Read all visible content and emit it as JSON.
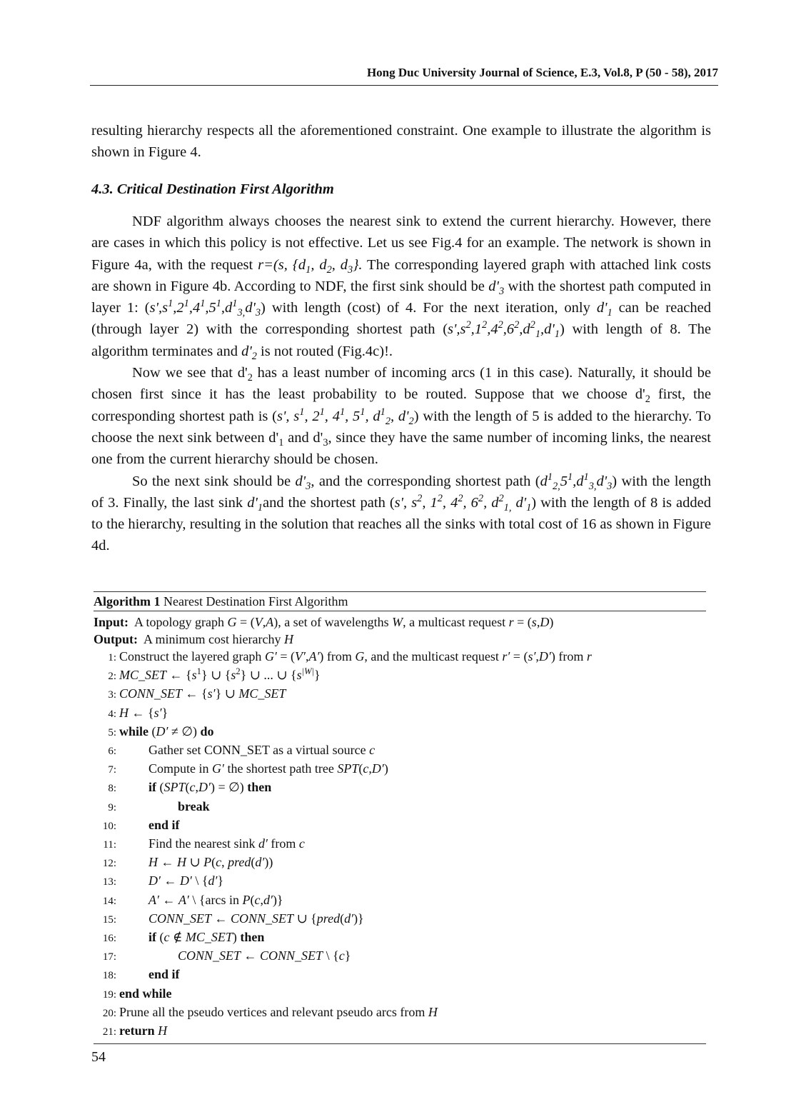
{
  "header": {
    "running_title": "Hong Duc University Journal of Science, E.3, Vol.8, P (50 - 58), 2017"
  },
  "paragraphs_top": [
    {
      "indent": false,
      "segments": [
        {
          "t": "resulting hierarchy respects all the aforementioned constraint. One example to illustrate the algorithm is shown in Figure 4."
        }
      ]
    }
  ],
  "section": {
    "heading": "4.3. Critical Destination First Algorithm"
  },
  "paragraphs_main": [
    {
      "indent": true,
      "segments": [
        {
          "t": "NDF algorithm always chooses the nearest sink to extend the current hierarchy. However, there are cases in which this policy is not effective. Let us see Fig.4 for an example. The network is shown in Figure 4a, with the request "
        },
        {
          "t": "r=(s, {d",
          "i": true
        },
        {
          "t": "1",
          "i": true,
          "sub": true
        },
        {
          "t": ", d",
          "i": true
        },
        {
          "t": "2",
          "i": true,
          "sub": true
        },
        {
          "t": ", d",
          "i": true
        },
        {
          "t": "3",
          "i": true,
          "sub": true
        },
        {
          "t": "}.",
          "i": true
        },
        {
          "t": " The corresponding layered graph with attached link costs are shown in Figure 4b. According to NDF, the first sink should be "
        },
        {
          "t": "d'",
          "i": true
        },
        {
          "t": "3",
          "i": true,
          "sub": true
        },
        {
          "t": " with the shortest path computed in layer 1: ("
        },
        {
          "t": "s',s",
          "i": true
        },
        {
          "t": "1",
          "i": true,
          "sup": true
        },
        {
          "t": ",2",
          "i": true
        },
        {
          "t": "1",
          "i": true,
          "sup": true
        },
        {
          "t": ",4",
          "i": true
        },
        {
          "t": "1",
          "i": true,
          "sup": true
        },
        {
          "t": ",5",
          "i": true
        },
        {
          "t": "1",
          "i": true,
          "sup": true
        },
        {
          "t": ",d",
          "i": true
        },
        {
          "t": "1",
          "i": true,
          "sup": true
        },
        {
          "t": "3,",
          "i": true,
          "sub": true
        },
        {
          "t": "d'",
          "i": true
        },
        {
          "t": "3",
          "i": true,
          "sub": true
        },
        {
          "t": ") with length (cost) of 4. For the next iteration, only "
        },
        {
          "t": "d'",
          "i": true
        },
        {
          "t": "1",
          "i": true,
          "sub": true
        },
        {
          "t": " can be reached (through layer 2) with the corresponding shortest path ("
        },
        {
          "t": "s',s",
          "i": true
        },
        {
          "t": "2",
          "i": true,
          "sup": true
        },
        {
          "t": ",1",
          "i": true
        },
        {
          "t": "2",
          "i": true,
          "sup": true
        },
        {
          "t": ",4",
          "i": true
        },
        {
          "t": "2",
          "i": true,
          "sup": true
        },
        {
          "t": ",6",
          "i": true
        },
        {
          "t": "2",
          "i": true,
          "sup": true
        },
        {
          "t": ",d",
          "i": true
        },
        {
          "t": "2",
          "i": true,
          "sup": true
        },
        {
          "t": "1",
          "i": true,
          "sub": true
        },
        {
          "t": ",d'",
          "i": true
        },
        {
          "t": "1",
          "i": true,
          "sub": true
        },
        {
          "t": ") with length of 8. The algorithm terminates and "
        },
        {
          "t": "d'",
          "i": true
        },
        {
          "t": "2",
          "i": true,
          "sub": true
        },
        {
          "t": " is not routed (Fig.4c)!."
        }
      ]
    },
    {
      "indent": true,
      "segments": [
        {
          "t": "Now we see that d'"
        },
        {
          "t": "2",
          "sub": true
        },
        {
          "t": " has a least number of incoming arcs (1 in this case). Naturally, it should be chosen first since it has the least probability to be routed. Suppose that we choose d'"
        },
        {
          "t": "2",
          "sub": true
        },
        {
          "t": " first, the corresponding shortest path is ("
        },
        {
          "t": "s', s",
          "i": true
        },
        {
          "t": "1",
          "i": true,
          "sup": true
        },
        {
          "t": ", 2",
          "i": true
        },
        {
          "t": "1",
          "i": true,
          "sup": true
        },
        {
          "t": ", 4",
          "i": true
        },
        {
          "t": "1",
          "i": true,
          "sup": true
        },
        {
          "t": ", 5",
          "i": true
        },
        {
          "t": "1",
          "i": true,
          "sup": true
        },
        {
          "t": ", d",
          "i": true
        },
        {
          "t": "1",
          "i": true,
          "sup": true
        },
        {
          "t": "2",
          "i": true,
          "sub": true
        },
        {
          "t": ", d'",
          "i": true
        },
        {
          "t": "2",
          "i": true,
          "sub": true
        },
        {
          "t": ") with the length of 5 is added to the hierarchy. To choose the next sink between d'"
        },
        {
          "t": "1",
          "sub": true
        },
        {
          "t": " and d'"
        },
        {
          "t": "3",
          "sub": true
        },
        {
          "t": ", since they have the same number of incoming links, the nearest one from the current hierarchy should be chosen."
        }
      ]
    },
    {
      "indent": true,
      "segments": [
        {
          "t": "So the next sink should be "
        },
        {
          "t": "d'",
          "i": true
        },
        {
          "t": "3",
          "i": true,
          "sub": true
        },
        {
          "t": ", and the corresponding shortest path ("
        },
        {
          "t": "d",
          "i": true
        },
        {
          "t": "1",
          "i": true,
          "sup": true
        },
        {
          "t": "2,",
          "i": true,
          "sub": true
        },
        {
          "t": "5",
          "i": true
        },
        {
          "t": "1",
          "i": true,
          "sup": true
        },
        {
          "t": ",d",
          "i": true
        },
        {
          "t": "1",
          "i": true,
          "sup": true
        },
        {
          "t": "3,",
          "i": true,
          "sub": true
        },
        {
          "t": "d'",
          "i": true
        },
        {
          "t": "3",
          "i": true,
          "sub": true
        },
        {
          "t": ") with the length of 3. Finally, the last sink "
        },
        {
          "t": "d'",
          "i": true
        },
        {
          "t": "1",
          "i": true,
          "sub": true
        },
        {
          "t": "and the shortest path ("
        },
        {
          "t": "s', s",
          "i": true
        },
        {
          "t": "2",
          "i": true,
          "sup": true
        },
        {
          "t": ", 1",
          "i": true
        },
        {
          "t": "2",
          "i": true,
          "sup": true
        },
        {
          "t": ", 4",
          "i": true
        },
        {
          "t": "2",
          "i": true,
          "sup": true
        },
        {
          "t": ", 6",
          "i": true
        },
        {
          "t": "2",
          "i": true,
          "sup": true
        },
        {
          "t": ", d",
          "i": true
        },
        {
          "t": "2",
          "i": true,
          "sup": true
        },
        {
          "t": "1,",
          "i": true,
          "sub": true
        },
        {
          "t": " d'",
          "i": true
        },
        {
          "t": "1",
          "i": true,
          "sub": true
        },
        {
          "t": ") with the length of 8 is added to the hierarchy, resulting in the solution that reaches all the sinks with total cost of 16 as shown in Figure 4d."
        }
      ]
    }
  ],
  "algorithm": {
    "caption_label": "Algorithm 1",
    "caption_title": "Nearest Destination First Algorithm",
    "input_label": "Input:",
    "input_segments": [
      {
        "t": "A topology graph "
      },
      {
        "t": "G",
        "i": true
      },
      {
        "t": " = ("
      },
      {
        "t": "V",
        "i": true
      },
      {
        "t": ","
      },
      {
        "t": "A",
        "i": true
      },
      {
        "t": "), a set of wavelengths "
      },
      {
        "t": "W",
        "i": true
      },
      {
        "t": ", a multicast request "
      },
      {
        "t": "r",
        "i": true
      },
      {
        "t": " = ("
      },
      {
        "t": "s",
        "i": true
      },
      {
        "t": ","
      },
      {
        "t": "D",
        "i": true
      },
      {
        "t": ")"
      }
    ],
    "output_label": "Output:",
    "output_segments": [
      {
        "t": "A minimum cost hierarchy "
      },
      {
        "t": "H",
        "i": true
      }
    ],
    "lines": [
      {
        "n": "1:",
        "level": 0,
        "segments": [
          {
            "t": "Construct the layered graph "
          },
          {
            "t": "G′",
            "i": true
          },
          {
            "t": " = ("
          },
          {
            "t": "V′",
            "i": true
          },
          {
            "t": ","
          },
          {
            "t": "A′",
            "i": true
          },
          {
            "t": ") from "
          },
          {
            "t": "G",
            "i": true
          },
          {
            "t": ", and the multicast request "
          },
          {
            "t": "r′",
            "i": true
          },
          {
            "t": " = ("
          },
          {
            "t": "s′",
            "i": true
          },
          {
            "t": ","
          },
          {
            "t": "D′",
            "i": true
          },
          {
            "t": ") from "
          },
          {
            "t": "r",
            "i": true
          }
        ]
      },
      {
        "n": "2:",
        "level": 0,
        "segments": [
          {
            "t": "MC_SET",
            "i": true
          },
          {
            "t": " ← {"
          },
          {
            "t": "s",
            "i": true
          },
          {
            "t": "1",
            "sup": true
          },
          {
            "t": "} ∪ {"
          },
          {
            "t": "s",
            "i": true
          },
          {
            "t": "2",
            "sup": true
          },
          {
            "t": "} ∪ ... ∪ {"
          },
          {
            "t": "s",
            "i": true
          },
          {
            "t": "|W|",
            "i": true,
            "sup": true
          },
          {
            "t": "}"
          }
        ]
      },
      {
        "n": "3:",
        "level": 0,
        "segments": [
          {
            "t": "CONN_SET",
            "i": true
          },
          {
            "t": " ← {"
          },
          {
            "t": "s′",
            "i": true
          },
          {
            "t": "} ∪ "
          },
          {
            "t": "MC_SET",
            "i": true
          }
        ]
      },
      {
        "n": "4:",
        "level": 0,
        "segments": [
          {
            "t": "H",
            "i": true
          },
          {
            "t": " ← {"
          },
          {
            "t": "s′",
            "i": true
          },
          {
            "t": "}"
          }
        ]
      },
      {
        "n": "5:",
        "level": 0,
        "segments": [
          {
            "t": "while",
            "b": true
          },
          {
            "t": " ("
          },
          {
            "t": "D′",
            "i": true
          },
          {
            "t": " ≠ ∅) "
          },
          {
            "t": "do",
            "b": true
          }
        ]
      },
      {
        "n": "6:",
        "level": 1,
        "segments": [
          {
            "t": "Gather set CONN_SET as a virtual source "
          },
          {
            "t": "c",
            "i": true
          }
        ]
      },
      {
        "n": "7:",
        "level": 1,
        "segments": [
          {
            "t": "Compute in "
          },
          {
            "t": "G′",
            "i": true
          },
          {
            "t": " the shortest path tree "
          },
          {
            "t": "SPT",
            "i": true
          },
          {
            "t": "("
          },
          {
            "t": "c",
            "i": true
          },
          {
            "t": ","
          },
          {
            "t": "D′",
            "i": true
          },
          {
            "t": ")"
          }
        ]
      },
      {
        "n": "8:",
        "level": 1,
        "segments": [
          {
            "t": "if",
            "b": true
          },
          {
            "t": " ("
          },
          {
            "t": "SPT",
            "i": true
          },
          {
            "t": "("
          },
          {
            "t": "c",
            "i": true
          },
          {
            "t": ","
          },
          {
            "t": "D′",
            "i": true
          },
          {
            "t": ") = ∅) "
          },
          {
            "t": "then",
            "b": true
          }
        ]
      },
      {
        "n": "9:",
        "level": 2,
        "segments": [
          {
            "t": "break",
            "b": true
          }
        ]
      },
      {
        "n": "10:",
        "level": 1,
        "segments": [
          {
            "t": "end if",
            "b": true
          }
        ]
      },
      {
        "n": "11:",
        "level": 1,
        "segments": [
          {
            "t": "Find the nearest sink "
          },
          {
            "t": "d′",
            "i": true
          },
          {
            "t": " from "
          },
          {
            "t": "c",
            "i": true
          }
        ]
      },
      {
        "n": "12:",
        "level": 1,
        "segments": [
          {
            "t": "H",
            "i": true
          },
          {
            "t": " ← "
          },
          {
            "t": "H",
            "i": true
          },
          {
            "t": " ∪ "
          },
          {
            "t": "P",
            "i": true
          },
          {
            "t": "("
          },
          {
            "t": "c",
            "i": true
          },
          {
            "t": ", "
          },
          {
            "t": "pred",
            "i": true
          },
          {
            "t": "("
          },
          {
            "t": "d′",
            "i": true
          },
          {
            "t": "))"
          }
        ]
      },
      {
        "n": "13:",
        "level": 1,
        "segments": [
          {
            "t": "D′",
            "i": true
          },
          {
            "t": " ← "
          },
          {
            "t": "D′",
            "i": true
          },
          {
            "t": " \\ {"
          },
          {
            "t": "d′",
            "i": true
          },
          {
            "t": "}"
          }
        ]
      },
      {
        "n": "14:",
        "level": 1,
        "segments": [
          {
            "t": "A′",
            "i": true
          },
          {
            "t": " ← "
          },
          {
            "t": "A′",
            "i": true
          },
          {
            "t": " \\ {arcs in "
          },
          {
            "t": "P",
            "i": true
          },
          {
            "t": "("
          },
          {
            "t": "c",
            "i": true
          },
          {
            "t": ","
          },
          {
            "t": "d′",
            "i": true
          },
          {
            "t": ")}"
          }
        ]
      },
      {
        "n": "15:",
        "level": 1,
        "segments": [
          {
            "t": "CONN_SET",
            "i": true
          },
          {
            "t": " ← "
          },
          {
            "t": "CONN_SET",
            "i": true
          },
          {
            "t": " ∪ {"
          },
          {
            "t": "pred",
            "i": true
          },
          {
            "t": "("
          },
          {
            "t": "d′",
            "i": true
          },
          {
            "t": ")}"
          }
        ]
      },
      {
        "n": "16:",
        "level": 1,
        "segments": [
          {
            "t": "if",
            "b": true
          },
          {
            "t": " ("
          },
          {
            "t": "c",
            "i": true
          },
          {
            "t": " ∉ "
          },
          {
            "t": "MC_SET",
            "i": true
          },
          {
            "t": ") "
          },
          {
            "t": "then",
            "b": true
          }
        ]
      },
      {
        "n": "17:",
        "level": 2,
        "segments": [
          {
            "t": "CONN_SET",
            "i": true
          },
          {
            "t": " ← "
          },
          {
            "t": "CONN_SET",
            "i": true
          },
          {
            "t": " \\ {"
          },
          {
            "t": "c",
            "i": true
          },
          {
            "t": "}"
          }
        ]
      },
      {
        "n": "18:",
        "level": 1,
        "segments": [
          {
            "t": "end if",
            "b": true
          }
        ]
      },
      {
        "n": "19:",
        "level": 0,
        "segments": [
          {
            "t": "end while",
            "b": true
          }
        ]
      },
      {
        "n": "20:",
        "level": 0,
        "segments": [
          {
            "t": "Prune all the pseudo vertices and relevant pseudo arcs from "
          },
          {
            "t": "H",
            "i": true
          }
        ]
      },
      {
        "n": "21:",
        "level": 0,
        "segments": [
          {
            "t": "return",
            "b": true
          },
          {
            "t": "  "
          },
          {
            "t": "H",
            "i": true
          }
        ]
      }
    ]
  },
  "footer": {
    "page_number": "54"
  }
}
